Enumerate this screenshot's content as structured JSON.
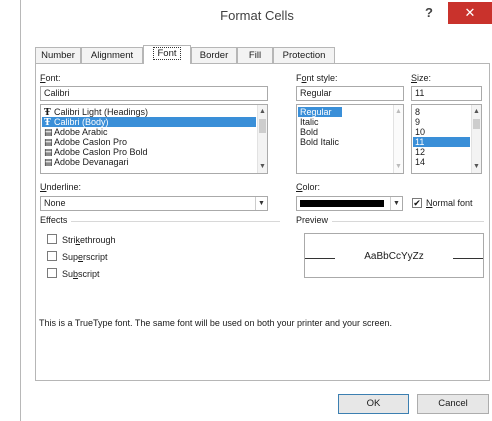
{
  "window": {
    "title": "Format Cells",
    "help_glyph": "?",
    "close_glyph": "✕"
  },
  "tabs": [
    {
      "label": "Number"
    },
    {
      "label": "Alignment"
    },
    {
      "label": "Font",
      "active": true
    },
    {
      "label": "Border"
    },
    {
      "label": "Fill"
    },
    {
      "label": "Protection"
    }
  ],
  "font": {
    "label_pre": "",
    "label_key": "F",
    "label_post": "ont:",
    "value": "Calibri",
    "list": [
      {
        "label": "Calibri Light (Headings)",
        "icon": "truetype-font-icon"
      },
      {
        "label": "Calibri (Body)",
        "icon": "truetype-font-icon",
        "selected": true
      },
      {
        "label": "Adobe Arabic",
        "icon": "opentype-font-icon"
      },
      {
        "label": "Adobe Caslon Pro",
        "icon": "opentype-font-icon"
      },
      {
        "label": "Adobe Caslon Pro Bold",
        "icon": "opentype-font-icon"
      },
      {
        "label": "Adobe Devanagari",
        "icon": "opentype-font-icon"
      }
    ]
  },
  "font_style": {
    "label_pre": "F",
    "label_key": "o",
    "label_post": "nt style:",
    "value": "Regular",
    "list": [
      {
        "label": "Regular",
        "selected": true
      },
      {
        "label": "Italic"
      },
      {
        "label": "Bold"
      },
      {
        "label": "Bold Italic"
      }
    ]
  },
  "size": {
    "label_pre": "",
    "label_key": "S",
    "label_post": "ize:",
    "value": "11",
    "list": [
      {
        "label": "8"
      },
      {
        "label": "9"
      },
      {
        "label": "10"
      },
      {
        "label": "11",
        "selected": true
      },
      {
        "label": "12"
      },
      {
        "label": "14"
      }
    ]
  },
  "underline": {
    "label_pre": "",
    "label_key": "U",
    "label_post": "nderline:",
    "value": "None"
  },
  "color": {
    "label_pre": "",
    "label_key": "C",
    "label_post": "olor:",
    "swatch": "#000000"
  },
  "normal_font": {
    "checked": true,
    "mark": "✔",
    "label_pre": "",
    "label_key": "N",
    "label_post": "ormal font"
  },
  "effects": {
    "title": "Effects",
    "items": [
      {
        "label_pre": "Stri",
        "label_key": "k",
        "label_post": "ethrough",
        "checked": false
      },
      {
        "label_pre": "Sup",
        "label_key": "e",
        "label_post": "rscript",
        "checked": false
      },
      {
        "label_pre": "Su",
        "label_key": "b",
        "label_post": "script",
        "checked": false
      }
    ]
  },
  "preview": {
    "title": "Preview",
    "sample": "AaBbCcYyZz"
  },
  "note": "This is a TrueType font.  The same font will be used on both your printer and your screen.",
  "buttons": {
    "ok": "OK",
    "cancel": "Cancel"
  },
  "colors": {
    "accent": "#3a8fd8",
    "close": "#c9322c"
  }
}
